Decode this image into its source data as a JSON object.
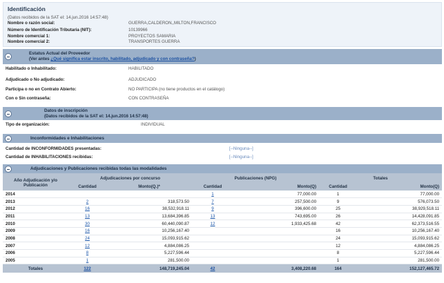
{
  "identificacion": {
    "title": "Identificación",
    "subtitle": "(Datos recibidos de la SAT el: 14.jun.2016 14:57:48)",
    "rows": [
      {
        "label": "Nombre o razón social:",
        "value": "GUERRA,CALDERON,,MILTON,FRANCISCO"
      },
      {
        "label": "Número de Identificación Tributaria (NIT):",
        "value": "10139966"
      },
      {
        "label": "Nombre comercial 1:",
        "value": "PROYECTOS SAMARIA"
      },
      {
        "label": "Nombre comercial 2:",
        "value": "TRANSPORTES GUERRA"
      }
    ]
  },
  "estatus": {
    "title": "Estatus Actual del Proveedor",
    "subtitle_prefix": "(Ver antes ",
    "subtitle_link": "¿Qué significa estar inscrito, habilitado, adjudicado y con contraseña?",
    "subtitle_suffix": ")",
    "rows": [
      {
        "label": "Habilitado o Inhabilitado:",
        "value": "HABILITADO"
      },
      {
        "label": "Adjudicado o No adjudicado:",
        "value": "ADJUDICADO"
      },
      {
        "label": "Participa o no en Contrato Abierto:",
        "value": "NO PARTICIPA (no tiene productos en el catálogo)"
      },
      {
        "label": "Con o Sin contraseña:",
        "value": "CON CONTRASEÑA"
      }
    ]
  },
  "inscripcion": {
    "title": "Datos de inscripción",
    "subtitle": "(Datos recibidos de la SAT el: 14.jun.2016 14:57:48)",
    "row": {
      "label": "Tipo de organización:",
      "value": "INDIVIDUAL"
    }
  },
  "inconformidades": {
    "title": "Inconformidades e Inhabilitaciones",
    "rows": [
      {
        "label": "Cantidad de INCONFORMIDADES presentadas:",
        "value": "[--Ninguna--]"
      },
      {
        "label": "Cantidad de INHABILITACIONES recibidas:",
        "value": "[--Ninguna--]"
      }
    ]
  },
  "adjudicaciones": {
    "title": "Adjudicaciones y Publicaciones recibidas todas las modalidades",
    "group_headers": [
      "Adjudicaciones por concurso",
      "Publicaciones (NPG)",
      "Totales"
    ],
    "year_header": "Año Adjudicación y/o Publicación",
    "col_headers": [
      "Cantidad",
      "Monto(Q.)*",
      "Cantidad",
      "Monto(Q)",
      "Cantidad",
      "Monto(Q)"
    ],
    "rows": [
      {
        "year": "2014",
        "c1": "",
        "m1": "",
        "c2": "1",
        "m2": "77,000.00",
        "c3": "1",
        "m3": "77,000.00"
      },
      {
        "year": "2013",
        "c1": "2",
        "m1": "318,573.50",
        "c2": "7",
        "m2": "257,500.00",
        "c3": "9",
        "m3": "576,073.50"
      },
      {
        "year": "2012",
        "c1": "16",
        "m1": "38,532,918.11",
        "c2": "9",
        "m2": "396,600.00",
        "c3": "25",
        "m3": "38,929,518.11"
      },
      {
        "year": "2011",
        "c1": "13",
        "m1": "13,684,396.85",
        "c2": "13",
        "m2": "743,695.00",
        "c3": "26",
        "m3": "14,428,091.85"
      },
      {
        "year": "2010",
        "c1": "30",
        "m1": "60,440,090.87",
        "c2": "12",
        "m2": "1,933,425.68",
        "c3": "42",
        "m3": "62,373,516.55"
      },
      {
        "year": "2009",
        "c1": "16",
        "m1": "10,256,167.40",
        "c2": "",
        "m2": "",
        "c3": "16",
        "m3": "10,256,167.40"
      },
      {
        "year": "2008",
        "c1": "24",
        "m1": "15,093,915.62",
        "c2": "",
        "m2": "",
        "c3": "24",
        "m3": "15,093,915.62"
      },
      {
        "year": "2007",
        "c1": "12",
        "m1": "4,884,086.25",
        "c2": "",
        "m2": "",
        "c3": "12",
        "m3": "4,884,086.25"
      },
      {
        "year": "2006",
        "c1": "8",
        "m1": "5,227,596.44",
        "c2": "",
        "m2": "",
        "c3": "8",
        "m3": "5,227,596.44"
      },
      {
        "year": "2005",
        "c1": "1",
        "m1": "281,500.00",
        "c2": "",
        "m2": "",
        "c3": "1",
        "m3": "281,500.00"
      }
    ],
    "totals": {
      "label": "Totales",
      "c1": "122",
      "m1": "148,719,245.04",
      "c2": "42",
      "m2": "3,408,220.68",
      "c3": "164",
      "m3": "152,127,465.72"
    }
  }
}
